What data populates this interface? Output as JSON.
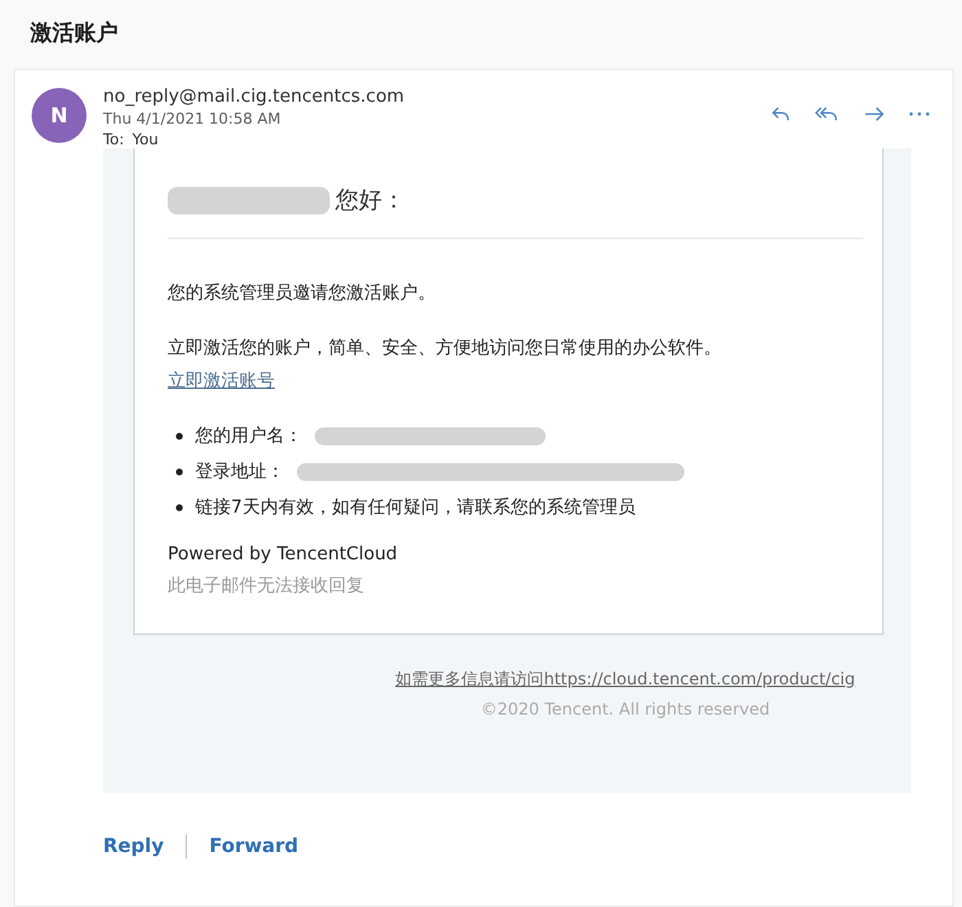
{
  "subject": "激活账户",
  "message": {
    "avatar": "N",
    "sender": "no_reply@mail.cig.tencentcs.com",
    "date": "Thu 4/1/2021 10:58 AM",
    "to_label": "To:",
    "to": "You"
  },
  "body": {
    "greeting": {
      "redacted": true,
      "text": "您好："
    },
    "paragraphs": [
      "您的系统管理员邀请您激活账户。",
      "立即激活您的账户，简单、安全、方便地访问您日常使用的办公软件。"
    ],
    "link": "立即激活账号",
    "items": [
      {
        "kind": "redacted",
        "label": "您的用户名："
      },
      {
        "kind": "redacted",
        "label": "登录地址："
      },
      {
        "kind": "text",
        "label": "链接7天内有效，如有任何疑问，请联系您的系统管理员"
      }
    ],
    "powered": "Powered by TencentCloud",
    "no_reply": "此电子邮件无法接收回复"
  },
  "footer": {
    "info_link": "如需更多信息请访问https://cloud.tencent.com/product/cig",
    "copyright": "©2020 Tencent. All rights reserved"
  },
  "actions": [
    "Reply",
    "Forward"
  ]
}
